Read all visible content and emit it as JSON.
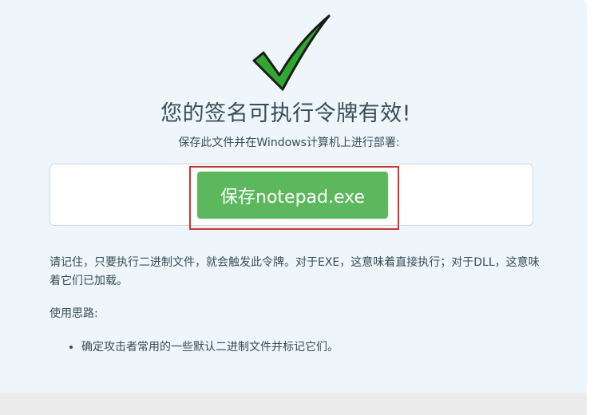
{
  "result": {
    "title": "您的签名可执行令牌有效!",
    "subtitle": "保存此文件并在Windows计算机上进行部署:"
  },
  "download": {
    "button_label": "保存notepad.exe"
  },
  "notes": {
    "reminder": "请记住，只要执行二进制文件，就会触发此令牌。对于EXE，这意味着直接执行；对于DLL，这意味着它们已加载。",
    "ideas_heading": "使用思路:",
    "ideas": [
      "确定攻击者常用的一些默认二进制文件并标记它们。"
    ]
  },
  "colors": {
    "panel_bg": "#eef6fc",
    "check_green": "#2ea82e",
    "button_green": "#5cb85c",
    "highlight_red": "#d9302f",
    "text": "#3b4a54"
  },
  "icons": {
    "success": "checkmark-icon"
  }
}
